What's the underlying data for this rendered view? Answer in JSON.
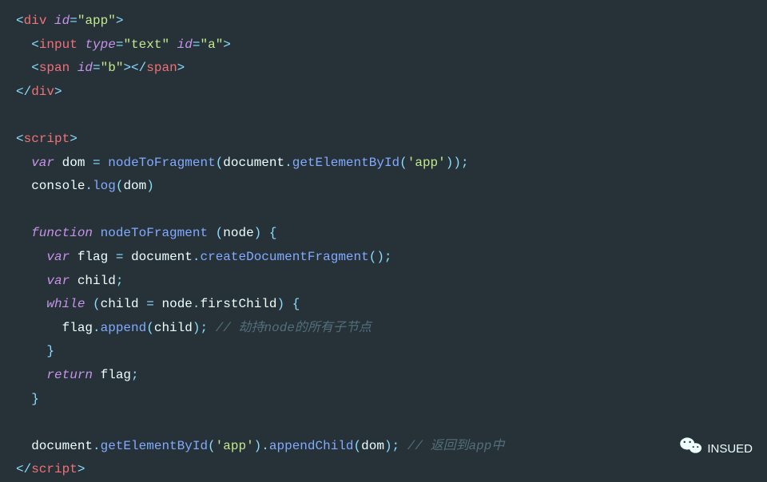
{
  "code": {
    "l1": {
      "tag": "div",
      "attr": "id",
      "val": "\"app\""
    },
    "l2": {
      "tag": "input",
      "attr1": "type",
      "val1": "\"text\"",
      "attr2": "id",
      "val2": "\"a\""
    },
    "l3": {
      "tag": "span",
      "attr": "id",
      "val": "\"b\""
    },
    "l4": {
      "tag": "div"
    },
    "l6": {
      "tag": "script"
    },
    "l7": {
      "kw": "var",
      "id": "dom",
      "fn": "nodeToFragment",
      "obj": "document",
      "m": "getElementById",
      "arg": "'app'"
    },
    "l8": {
      "obj": "console",
      "m": "log",
      "arg": "dom"
    },
    "l10": {
      "kw": "function",
      "fn": "nodeToFragment",
      "param": "node"
    },
    "l11": {
      "kw": "var",
      "id": "flag",
      "obj": "document",
      "m": "createDocumentFragment"
    },
    "l12": {
      "kw": "var",
      "id": "child"
    },
    "l13": {
      "kw": "while",
      "id": "child",
      "obj": "node",
      "prop": "firstChild"
    },
    "l14": {
      "obj": "flag",
      "m": "append",
      "arg": "child",
      "comment": "// 劫持node的所有子节点"
    },
    "l16": {
      "kw": "return",
      "id": "flag"
    },
    "l19": {
      "obj": "document",
      "m1": "getElementById",
      "arg1": "'app'",
      "m2": "appendChild",
      "arg2": "dom",
      "comment": "// 返回到app中"
    },
    "l20": {
      "tag": "script"
    }
  },
  "watermark": {
    "label": "INSUED"
  }
}
